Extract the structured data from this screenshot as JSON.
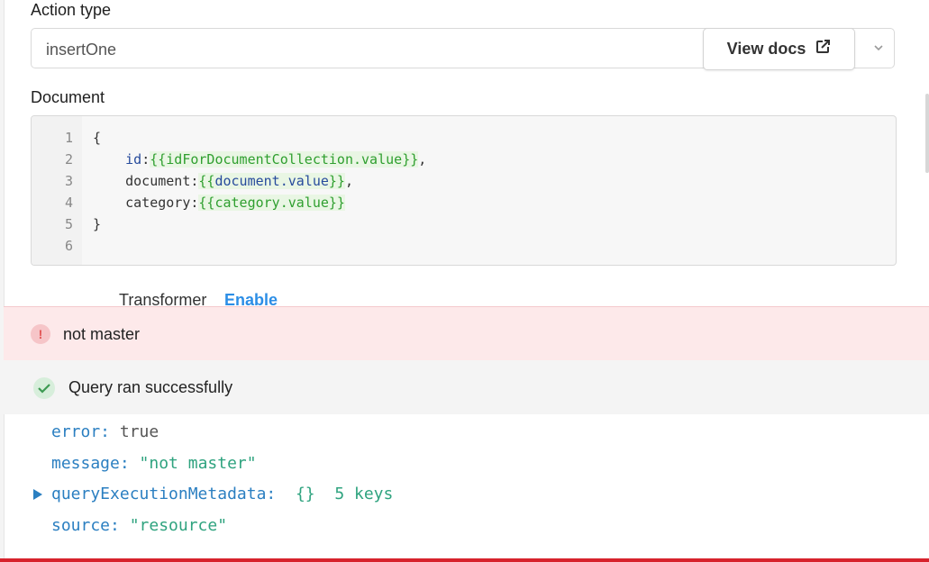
{
  "form": {
    "action_type_label": "Action type",
    "action_type_value": "insertOne",
    "view_docs_label": "View docs",
    "document_label": "Document"
  },
  "editor": {
    "line_numbers": [
      "1",
      "2",
      "3",
      "4",
      "5",
      "6"
    ],
    "lines": {
      "l1": "{",
      "l2_key": "id",
      "l2_tpl_open": "{{",
      "l2_tpl_expr": "idForDocumentCollection.value",
      "l2_tpl_close": "}}",
      "l3_key": "document",
      "l3_tpl_open": "{{",
      "l3_tpl_expr": "document.value",
      "l3_tpl_close": "}}",
      "l4_key": "category",
      "l4_tpl_open": "{{",
      "l4_tpl_expr": "category.value",
      "l4_tpl_close": "}}",
      "l5": "}"
    }
  },
  "transformer": {
    "label": "Transformer",
    "enable_label": "Enable"
  },
  "alerts": {
    "error_text": "not master",
    "success_text": "Query ran successfully"
  },
  "result": {
    "error_key": "error:",
    "error_value": "true",
    "message_key": "message:",
    "message_value": "\"not master\"",
    "meta_key": "queryExecutionMetadata:",
    "meta_value": "{}",
    "meta_count": "5 keys",
    "source_key": "source:",
    "source_value": "\"resource\""
  },
  "icons": {
    "external_link": "external-link-icon",
    "chevron_down": "chevron-down-icon",
    "error": "exclamation-icon",
    "success": "check-icon",
    "expand": "expand-triangle-icon"
  },
  "colors": {
    "error_bg": "#fde9ea",
    "success_bg": "#f4f4f4",
    "link": "#2c8ee6",
    "bottom_bar": "#d7222c"
  }
}
